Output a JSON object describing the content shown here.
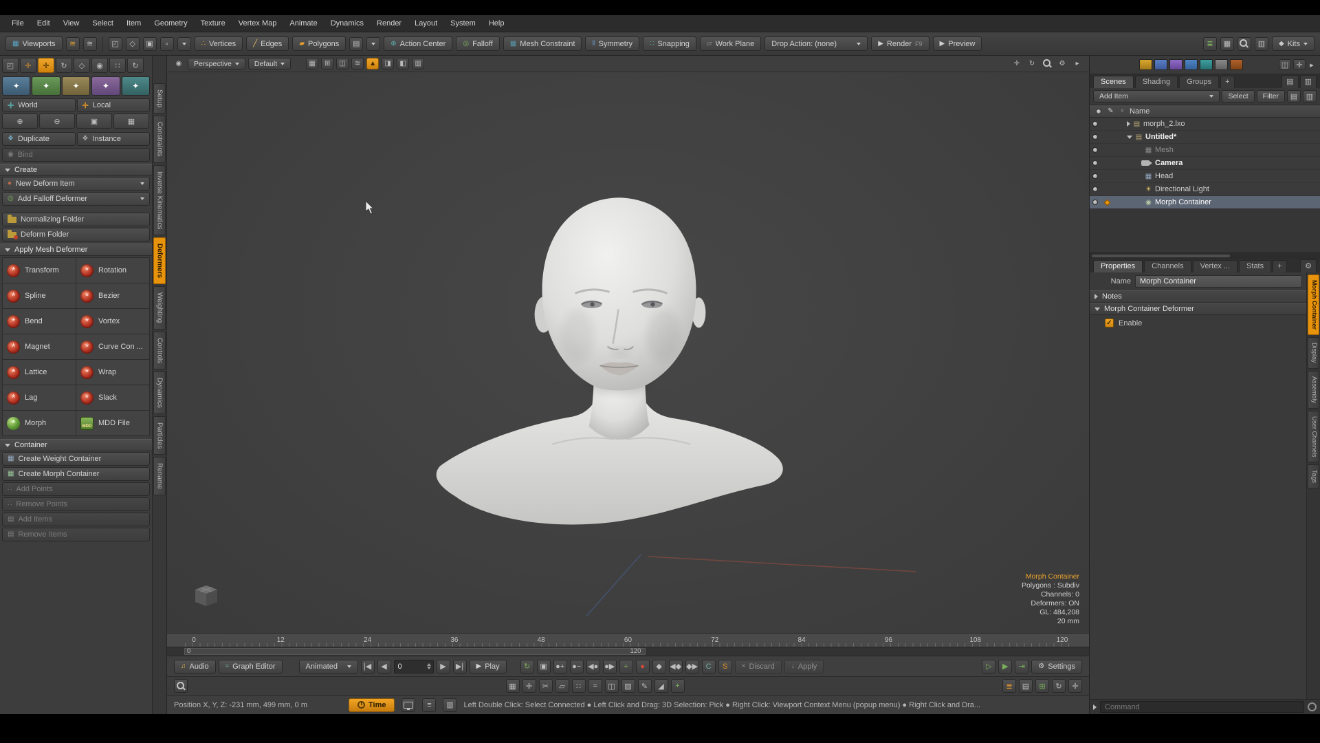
{
  "menubar": {
    "items": [
      "File",
      "Edit",
      "View",
      "Select",
      "Item",
      "Geometry",
      "Texture",
      "Vertex Map",
      "Animate",
      "Dynamics",
      "Render",
      "Layout",
      "System",
      "Help"
    ]
  },
  "toolbar": {
    "viewports_label": "Viewports",
    "vertices_label": "Vertices",
    "edges_label": "Edges",
    "polygons_label": "Polygons",
    "action_center_label": "Action Center",
    "falloff_label": "Falloff",
    "mesh_constraint_label": "Mesh Constraint",
    "symmetry_label": "Symmetry",
    "snapping_label": "Snapping",
    "work_plane_label": "Work Plane",
    "drop_action_label": "Drop Action: (none)",
    "render_label": "Render",
    "render_shortcut": "F9",
    "preview_label": "Preview",
    "kits_label": "Kits"
  },
  "left_tabs": {
    "items": [
      "Setup",
      "Constraints",
      "Inverse Kinematics",
      "Deformers",
      "Weighting",
      "Controls",
      "Dynamics",
      "Particles",
      "Rename"
    ],
    "active": "Deformers"
  },
  "tool_panel": {
    "world": "World",
    "local": "Local",
    "duplicate": "Duplicate",
    "instance": "Instance",
    "bind": "Bind",
    "create_header": "Create",
    "new_deform_item": "New Deform Item",
    "add_falloff_deformer": "Add Falloff Deformer",
    "normalizing_folder": "Normalizing Folder",
    "deform_folder": "Deform Folder",
    "apply_header": "Apply Mesh Deformer",
    "deformers": [
      "Transform",
      "Rotation",
      "Spline",
      "Bezier",
      "Bend",
      "Vortex",
      "Magnet",
      "Curve Con ...",
      "Lattice",
      "Wrap",
      "Lag",
      "Slack",
      "Morph",
      "MDD File"
    ],
    "mdd_badge": "MDD",
    "container_header": "Container",
    "create_weight_container": "Create Weight Container",
    "create_morph_container": "Create Morph Container",
    "add_points": "Add Points",
    "remove_points": "Remove Points",
    "add_items": "Add Items",
    "remove_items": "Remove Items"
  },
  "viewport": {
    "projection": "Perspective",
    "shading": "Default",
    "overlay": {
      "title": "Morph Container",
      "line1": "Polygons : Subdiv",
      "line2": "Channels: 0",
      "line3": "Deformers: ON",
      "line4": "GL: 484,208",
      "line5": "20 mm"
    }
  },
  "timeline": {
    "ticks": [
      "0",
      "12",
      "24",
      "36",
      "48",
      "60",
      "72",
      "84",
      "96",
      "108",
      "120"
    ],
    "range_start": "0",
    "range_end": "120"
  },
  "transport": {
    "audio": "Audio",
    "graph_editor": "Graph Editor",
    "mode": "Animated",
    "frame": "0",
    "play": "Play",
    "discard": "Discard",
    "apply": "Apply",
    "settings": "Settings"
  },
  "status": {
    "position": "Position X, Y, Z:   -231 mm, 499 mm, 0 m",
    "time": "Time",
    "help": "Left Double Click: Select Connected  ●  Left Click and Drag: 3D Selection: Pick  ●  Right Click: Viewport Context Menu (popup menu)  ●  Right Click and Dra..."
  },
  "scene_panel": {
    "tabs": [
      "Scenes",
      "Shading",
      "Groups"
    ],
    "add_item": "Add Item",
    "select": "Select",
    "filter": "Filter",
    "name_header": "Name",
    "rows": [
      {
        "label": "morph_2.lxo"
      },
      {
        "label": "Untitled*"
      },
      {
        "label": "Mesh"
      },
      {
        "label": "Camera"
      },
      {
        "label": "Head"
      },
      {
        "label": "Directional Light"
      },
      {
        "label": "Morph Container"
      }
    ]
  },
  "properties_panel": {
    "tabs": [
      "Properties",
      "Channels",
      "Vertex ...",
      "Stats"
    ],
    "name_label": "Name",
    "name_value": "Morph Container",
    "notes": "Notes",
    "section": "Morph Container Deformer",
    "enable": "Enable"
  },
  "right_tabs": {
    "items": [
      "Morph Container",
      "Display",
      "Assembly",
      "User Channels",
      "Tags"
    ],
    "active": "Morph Container"
  },
  "command": {
    "placeholder": "Command"
  }
}
